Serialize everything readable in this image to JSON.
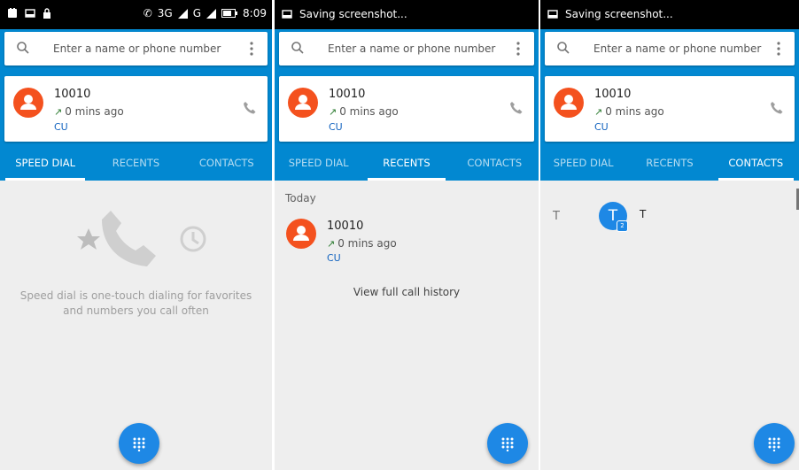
{
  "status_bar": {
    "network": "3G",
    "network2": "G",
    "time": "8:09",
    "saving_text": "Saving screenshot..."
  },
  "search": {
    "placeholder": "Enter a name or phone number"
  },
  "favorite_card": {
    "number": "10010",
    "ago": "0 mins ago",
    "carrier": "CU"
  },
  "tabs": [
    "SPEED DIAL",
    "RECENTS",
    "CONTACTS"
  ],
  "speed_dial": {
    "empty_line1": "Speed dial is one-touch dialing for favorites",
    "empty_line2": "and numbers you call often"
  },
  "recents": {
    "section": "Today",
    "items": [
      {
        "number": "10010",
        "ago": "0 mins ago",
        "carrier": "CU"
      }
    ],
    "view_full": "View full call history"
  },
  "contacts": {
    "section_letter": "T",
    "items": [
      {
        "initial": "T",
        "name": "T",
        "sim_badge": "2"
      }
    ]
  },
  "colors": {
    "primary": "#0288d1",
    "avatar": "#f4511e",
    "fab": "#1e88e5",
    "carrier": "#1565c0",
    "arrow": "#2e7d32"
  }
}
